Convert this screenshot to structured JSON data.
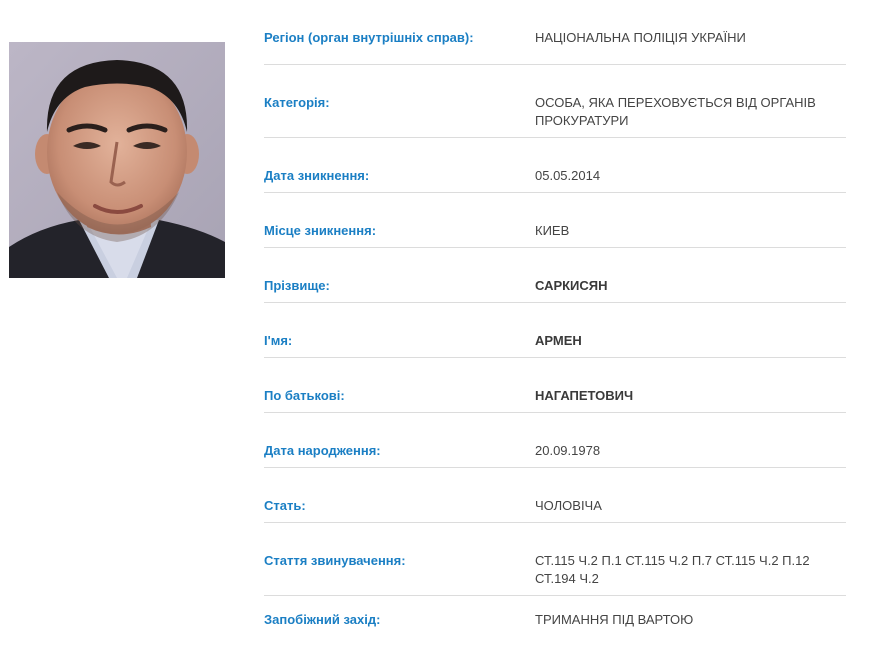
{
  "photo": {
    "icon": "person-photo"
  },
  "fields": [
    {
      "label": "Регіон (орган внутрішніх справ):",
      "value": "НАЦІОНАЛЬНА ПОЛІЦІЯ УКРАЇНИ"
    },
    {
      "label": "Категорія:",
      "value": "ОСОБА, ЯКА ПЕРЕХОВУЄТЬСЯ ВІД ОРГАНІВ ПРОКУРАТУРИ"
    },
    {
      "label": "Дата зникнення:",
      "value": "05.05.2014"
    },
    {
      "label": "Місце зникнення:",
      "value": "КИЕВ"
    },
    {
      "label": "Прізвище:",
      "value": "САРКИСЯН"
    },
    {
      "label": "І'мя:",
      "value": "АРМЕН"
    },
    {
      "label": "По батькові:",
      "value": "НАГАПЕТОВИЧ"
    },
    {
      "label": "Дата народження:",
      "value": "20.09.1978"
    },
    {
      "label": "Стать:",
      "value": "ЧОЛОВІЧА"
    },
    {
      "label": "Стаття звинувачення:",
      "value": "СТ.115 Ч.2 П.1 СТ.115 Ч.2 П.7 СТ.115 Ч.2 П.12 СТ.194 Ч.2"
    },
    {
      "label": "Запобіжний захід:",
      "value": "ТРИМАННЯ ПІД ВАРТОЮ"
    }
  ],
  "colors": {
    "label": "#1b7fc4",
    "value": "#444444",
    "divider": "#dcdcdc"
  }
}
